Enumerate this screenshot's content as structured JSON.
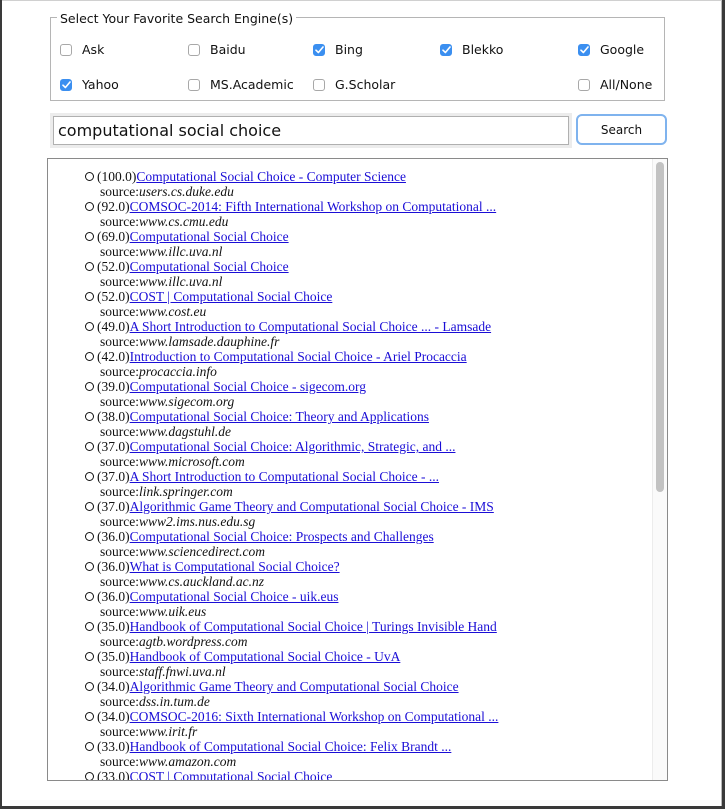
{
  "engine_group": {
    "legend": "Select Your Favorite Search Engine(s)",
    "options": [
      {
        "label": "Ask",
        "checked": false
      },
      {
        "label": "Baidu",
        "checked": false
      },
      {
        "label": "Bing",
        "checked": true
      },
      {
        "label": "Blekko",
        "checked": true
      },
      {
        "label": "Google",
        "checked": true
      },
      {
        "label": "Yahoo",
        "checked": true
      },
      {
        "label": "MS.Academic",
        "checked": false
      },
      {
        "label": "G.Scholar",
        "checked": false
      },
      {
        "label": "All/None",
        "checked": false
      }
    ]
  },
  "search": {
    "query": "computational social choice",
    "button_label": "Search"
  },
  "colors": {
    "link": "#1a0dd6",
    "checkbox_checked": "#3b8ff0",
    "button_focus_border": "#7fb3ee"
  },
  "results": {
    "source_prefix": "source:",
    "items": [
      {
        "score": "(100.0)",
        "title": "Computational Social Choice - Computer Science",
        "source": "users.cs.duke.edu"
      },
      {
        "score": "(92.0)",
        "title": "COMSOC-2014: Fifth International Workshop on Computational ...",
        "source": "www.cs.cmu.edu"
      },
      {
        "score": "(69.0)",
        "title": "Computational Social Choice",
        "source": "www.illc.uva.nl"
      },
      {
        "score": "(52.0)",
        "title": "Computational Social Choice",
        "source": "www.illc.uva.nl"
      },
      {
        "score": "(52.0)",
        "title": "COST | Computational Social Choice",
        "source": "www.cost.eu"
      },
      {
        "score": "(49.0)",
        "title": "A Short Introduction to Computational Social Choice ... - Lamsade",
        "source": "www.lamsade.dauphine.fr"
      },
      {
        "score": "(42.0)",
        "title": "Introduction to Computational Social Choice - Ariel Procaccia",
        "source": "procaccia.info"
      },
      {
        "score": "(39.0)",
        "title": "Computational Social Choice - sigecom.org",
        "source": "www.sigecom.org"
      },
      {
        "score": "(38.0)",
        "title": "Computational Social Choice: Theory and Applications",
        "source": "www.dagstuhl.de"
      },
      {
        "score": "(37.0)",
        "title": "Computational Social Choice: Algorithmic, Strategic, and ...",
        "source": "www.microsoft.com"
      },
      {
        "score": "(37.0)",
        "title": "A Short Introduction to Computational Social Choice - ...",
        "source": "link.springer.com"
      },
      {
        "score": "(37.0)",
        "title": "Algorithmic Game Theory and Computational Social Choice - IMS",
        "source": "www2.ims.nus.edu.sg"
      },
      {
        "score": "(36.0)",
        "title": "Computational Social Choice: Prospects and Challenges",
        "source": "www.sciencedirect.com"
      },
      {
        "score": "(36.0)",
        "title": "What is Computational Social Choice?",
        "source": "www.cs.auckland.ac.nz"
      },
      {
        "score": "(36.0)",
        "title": "Computational Social Choice - uik.eus",
        "source": "www.uik.eus"
      },
      {
        "score": "(35.0)",
        "title": "Handbook of Computational Social Choice | Turings Invisible Hand",
        "source": "agtb.wordpress.com"
      },
      {
        "score": "(35.0)",
        "title": "Handbook of Computational Social Choice - UvA",
        "source": "staff.fnwi.uva.nl"
      },
      {
        "score": "(34.0)",
        "title": "Algorithmic Game Theory and Computational Social Choice",
        "source": "dss.in.tum.de"
      },
      {
        "score": "(34.0)",
        "title": "COMSOC-2016: Sixth International Workshop on Computational ...",
        "source": "www.irit.fr"
      },
      {
        "score": "(33.0)",
        "title": "Handbook of Computational Social Choice: Felix Brandt ...",
        "source": "www.amazon.com"
      },
      {
        "score": "(33.0)",
        "title": "COST | Computational Social Choice",
        "source": ""
      }
    ]
  }
}
